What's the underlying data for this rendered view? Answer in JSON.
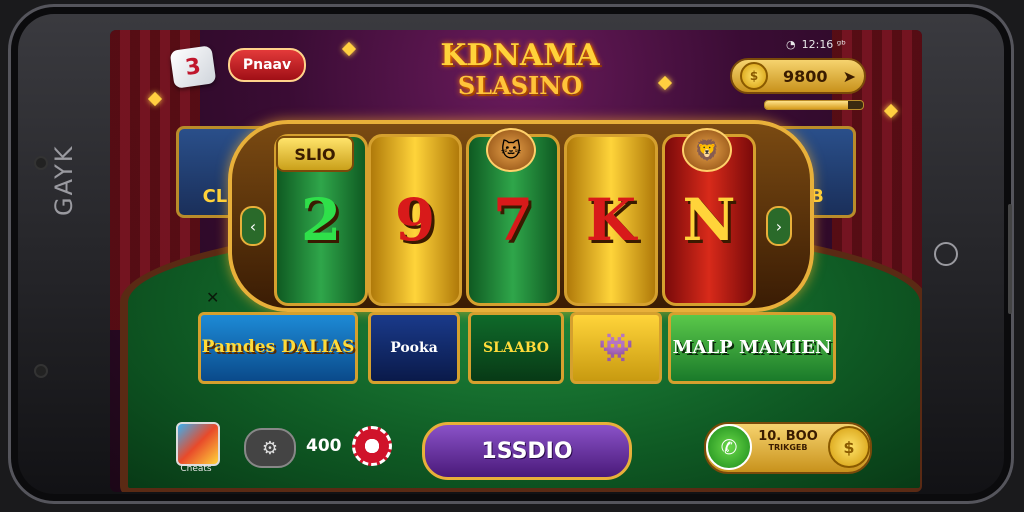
{
  "device": {
    "side_text": "GAYK"
  },
  "header": {
    "logo_glyph": "3",
    "red_button_label": "Pnaav",
    "title_line1": "KDNAMA",
    "title_line2": "SLASINO",
    "status_bar": "12:16 ᵍᵇ",
    "status_icon": "alarm-icon"
  },
  "balance": {
    "coins": "9800",
    "coin_glyph": "$",
    "arrow_glyph": "➤",
    "level_progress": 0.85
  },
  "side_cards": {
    "left": "CLLIK",
    "right": "SEIB"
  },
  "reels": {
    "label": "SLIO",
    "prev_glyph": "‹",
    "next_glyph": "›",
    "symbols": [
      "2",
      "9",
      "7",
      "K",
      "N"
    ],
    "colors": [
      "#2fe04a",
      "#d81a1a",
      "#d81a1a",
      "#d81a1a",
      "#ffd43a"
    ],
    "top_icons": [
      "cat-face-icon",
      "lion-face-icon"
    ]
  },
  "game_tiles": {
    "close_glyph": "✕",
    "tile1": "Pamdes DALIAS",
    "tile2": "Pooka",
    "tile3": "SLAABO",
    "tile4_icon": "blue-monster-icon",
    "tile5": "MALP MAMIEN"
  },
  "bottom": {
    "store_label": "Cheats",
    "gamepad_glyph": "⚙",
    "credits": "400",
    "spin_label": "1SSDIO",
    "phone_glyph": "✆",
    "bonus_line1": "10. BOO",
    "bonus_line2": "TRIKGEB",
    "bonus_coin_glyph": "$"
  }
}
